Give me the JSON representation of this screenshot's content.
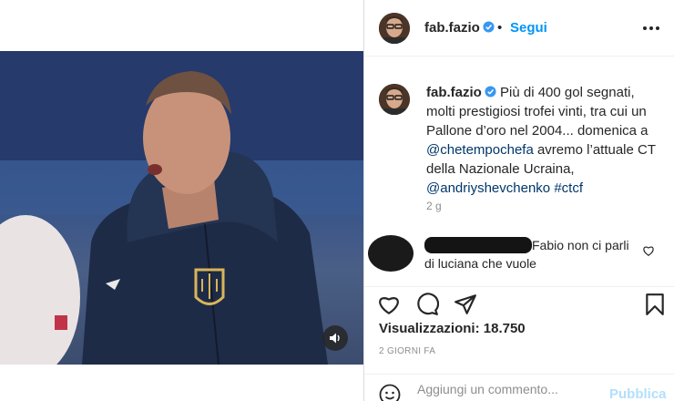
{
  "post": {
    "username": "fab.fazio",
    "follow_label": "Segui",
    "separator": "•",
    "caption_text": "Più di 400 gol segnati, molti prestigiosi trofei vinti, tra cui un Pallone d’oro nel 2004... domenica a",
    "mention_1": "@chetempochefa",
    "caption_text_2": "avremo l’attuale CT della Nazionale Ucraina,",
    "mention_2": "@andriyshevchenko",
    "hashtag": "#ctcf",
    "time_ago": "2 g",
    "comment_text": "Fabio non ci parli di luciana che vuole",
    "views_label": "Visualizzazioni:",
    "views_count": "18.750",
    "date_label": "2 GIORNI FA",
    "add_comment_placeholder": "Aggiungi un commento...",
    "publish_label": "Pubblica"
  },
  "icons": {
    "verified": "verified-badge-icon",
    "more": "more-options-icon",
    "like": "heart-icon",
    "comment": "comment-icon",
    "share": "share-icon",
    "save": "bookmark-icon",
    "sound": "speaker-icon",
    "emoji": "emoji-icon"
  },
  "colors": {
    "accent": "#0095f6",
    "link": "#00376b",
    "muted": "#8e8e8e",
    "publish_disabled": "#b2dffc",
    "verified": "#3897f0"
  }
}
